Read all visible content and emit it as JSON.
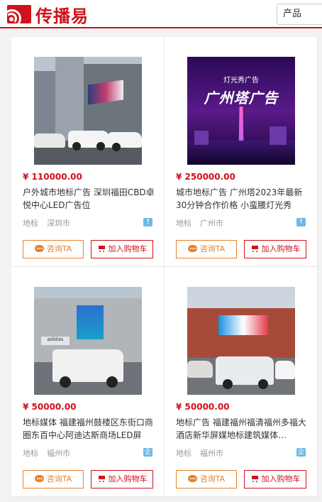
{
  "header": {
    "brand_name": "传播易",
    "search_select_value": "产品"
  },
  "products": [
    {
      "price": "¥ 110000.00",
      "title": "户外城市地标广告 深圳福田CBD卓悦中心LED广告位",
      "category": "地标",
      "city": "深圳市",
      "consult_label": "咨询TA",
      "cart_label": "加入购物车",
      "image_icon": "city-led-screen-image"
    },
    {
      "price": "¥ 250000.00",
      "title": "城市地标广告 广州塔2023年最新30分钟合作价格 小蛮腰灯光秀",
      "category": "地标",
      "city": "广州市",
      "consult_label": "咨询TA",
      "cart_label": "加入购物车",
      "image_icon": "canton-tower-image",
      "image_text_top": "灯光秀广告",
      "image_text_main": "广州塔广告"
    },
    {
      "price": "¥ 50000.00",
      "title": "地标媒体 福建福州鼓楼区东街口商圈东百中心阿迪达斯商场LED屏",
      "category": "地标",
      "city": "福州市",
      "consult_label": "咨询TA",
      "cart_label": "加入购物车",
      "image_icon": "mall-led-screen-image"
    },
    {
      "price": "¥ 50000.00",
      "title": "地标广告 福建福州福清福州多福大酒店新华屏媒地标建筑媒体…",
      "category": "地标",
      "city": "福州市",
      "consult_label": "咨询TA",
      "cart_label": "加入购物车",
      "image_icon": "hotel-led-screen-image"
    }
  ],
  "colors": {
    "brand": "#d0121b",
    "consult": "#e8822a",
    "badge": "#6fb8e8"
  }
}
